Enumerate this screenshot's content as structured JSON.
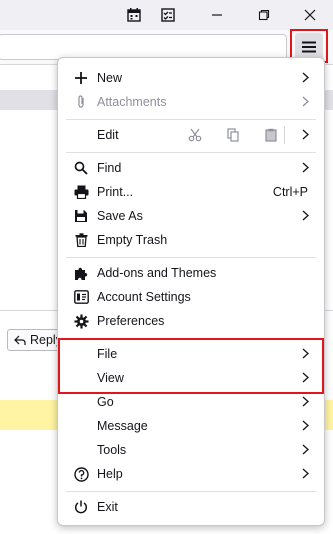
{
  "window": {
    "calendar_icon": "calendar-icon",
    "tasks_icon": "tasks-icon",
    "minimize_icon": "minimize-icon",
    "restore_icon": "restore-icon",
    "close_icon": "close-icon"
  },
  "toolbar": {
    "menu_icon": "hamburger-menu-icon"
  },
  "background": {
    "reply_label": "Reply"
  },
  "menu": {
    "new": "New",
    "attachments": "Attachments",
    "edit": "Edit",
    "find": "Find",
    "print": "Print...",
    "print_shortcut": "Ctrl+P",
    "save_as": "Save As",
    "empty_trash": "Empty Trash",
    "addons": "Add-ons and Themes",
    "account_settings": "Account Settings",
    "preferences": "Preferences",
    "file": "File",
    "view": "View",
    "go": "Go",
    "message": "Message",
    "tools": "Tools",
    "help": "Help",
    "exit": "Exit"
  },
  "colors": {
    "highlight": "#e0161b",
    "accent_yellow": "#fff4a3"
  }
}
